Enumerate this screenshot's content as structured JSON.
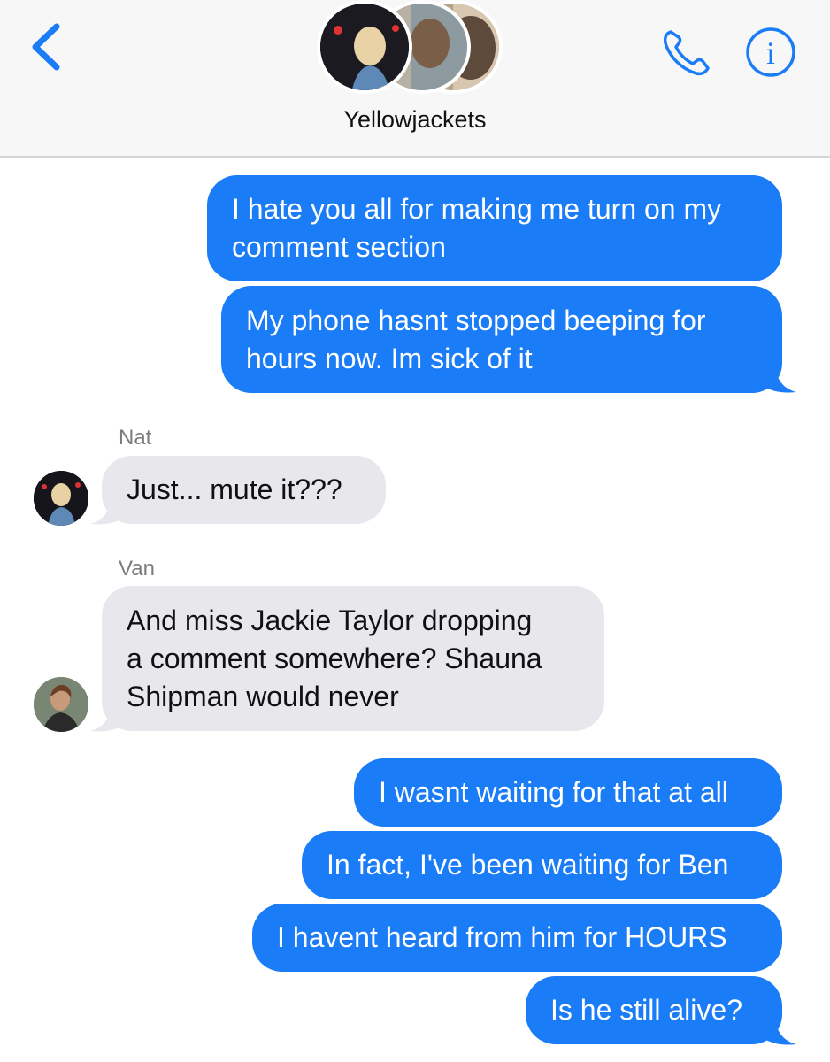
{
  "header": {
    "back_icon": "chevron-left-icon",
    "title": "Yellowjackets",
    "call_icon": "phone-icon",
    "info_icon": "info-icon",
    "info_glyph": "i",
    "accent_color": "#1a7cf6"
  },
  "messages": [
    {
      "direction": "outgoing",
      "lines": [
        "I hate you all for making me turn on my",
        "comment section"
      ]
    },
    {
      "direction": "outgoing",
      "lines": [
        "My phone hasnt stopped beeping for",
        "hours now. Im sick of it"
      ]
    },
    {
      "direction": "incoming",
      "sender": "Nat",
      "lines": [
        "Just... mute it???"
      ]
    },
    {
      "direction": "incoming",
      "sender": "Van",
      "lines": [
        "And miss Jackie Taylor dropping",
        "a comment somewhere? Shauna",
        "Shipman would never"
      ]
    },
    {
      "direction": "outgoing",
      "lines": [
        "I wasnt waiting for that at all"
      ]
    },
    {
      "direction": "outgoing",
      "lines": [
        "In fact, I've been waiting for Ben"
      ]
    },
    {
      "direction": "outgoing",
      "lines": [
        "I havent heard from him for HOURS"
      ]
    },
    {
      "direction": "outgoing",
      "lines": [
        "Is he still alive?"
      ]
    }
  ]
}
